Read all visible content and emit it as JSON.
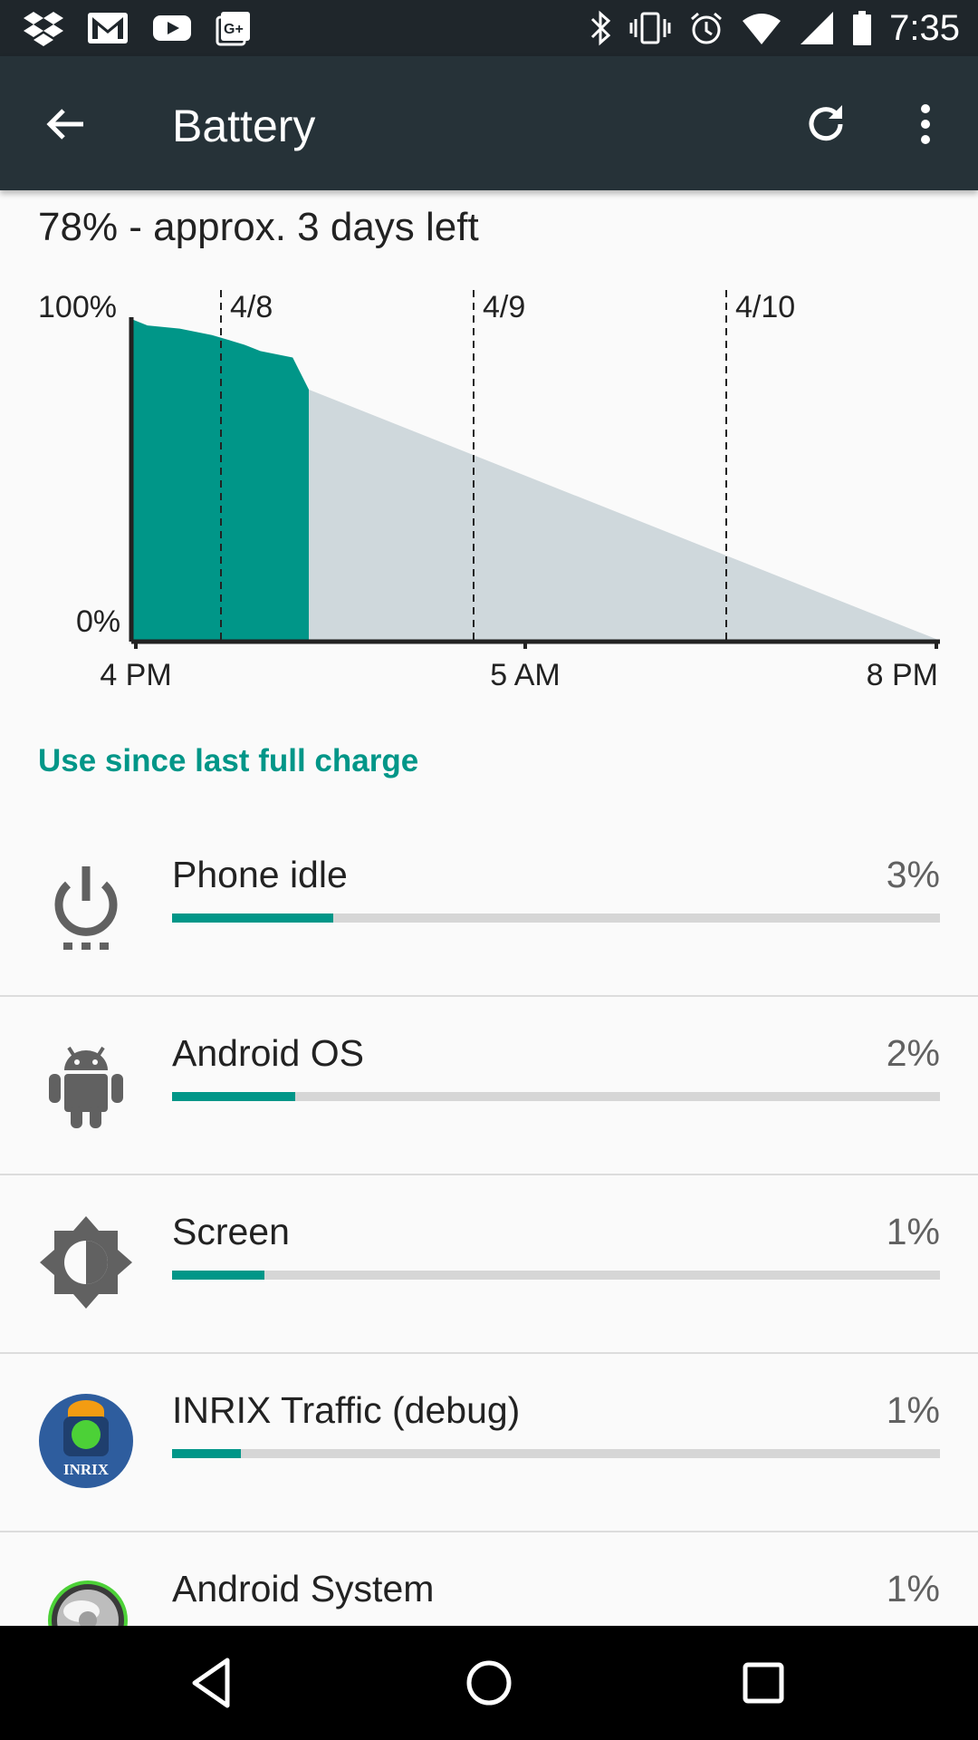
{
  "status_bar": {
    "time": "7:35",
    "left_icons": [
      "dropbox-icon",
      "gmail-icon",
      "youtube-icon",
      "google-plus-icon"
    ],
    "right_icons": [
      "bluetooth-icon",
      "vibrate-icon",
      "alarm-icon",
      "wifi-icon",
      "signal-icon",
      "battery-icon"
    ]
  },
  "toolbar": {
    "title": "Battery",
    "back_icon": "arrow-back-icon",
    "refresh_icon": "refresh-icon",
    "more_icon": "more-vert-icon"
  },
  "summary": "78% - approx. 3 days left",
  "chart_data": {
    "type": "area",
    "y_labels": [
      "100%",
      "0%"
    ],
    "x_labels": [
      "4 PM",
      "5 AM",
      "8 PM"
    ],
    "date_markers": [
      "4/8",
      "4/9",
      "4/10"
    ],
    "ylim": [
      0,
      100
    ],
    "actual_series": {
      "x": [
        0,
        0.02,
        0.06,
        0.1,
        0.14,
        0.16,
        0.2,
        0.22
      ],
      "y": [
        100,
        98,
        97,
        95,
        92,
        90,
        88,
        78
      ]
    },
    "projected_series": {
      "x": [
        0.22,
        1.0
      ],
      "y": [
        78,
        0
      ]
    },
    "colors": {
      "actual": "#009688",
      "projected": "#cfd8dc",
      "axis": "#222222"
    }
  },
  "section_title": "Use since last full charge",
  "apps": [
    {
      "name": "Phone idle",
      "percent": "3%",
      "bar_fraction": 0.21,
      "icon": "power-icon"
    },
    {
      "name": "Android OS",
      "percent": "2%",
      "bar_fraction": 0.16,
      "icon": "android-icon"
    },
    {
      "name": "Screen",
      "percent": "1%",
      "bar_fraction": 0.12,
      "icon": "brightness-icon"
    },
    {
      "name": "INRIX Traffic (debug)",
      "percent": "1%",
      "bar_fraction": 0.09,
      "icon": "inrix-app-icon",
      "icon_text": "INRIX"
    },
    {
      "name": "Android System",
      "percent": "1%",
      "bar_fraction": 0.07,
      "icon": "android-system-icon"
    }
  ],
  "nav": {
    "back_icon": "nav-back-icon",
    "home_icon": "nav-home-icon",
    "recents_icon": "nav-recents-icon"
  }
}
